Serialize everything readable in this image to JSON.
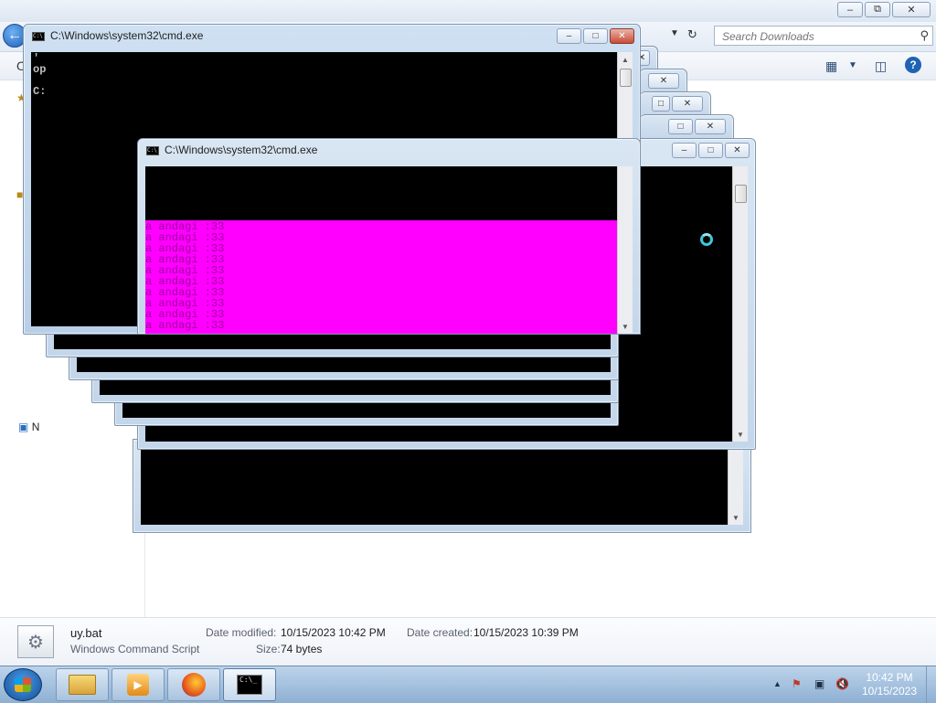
{
  "explorer": {
    "search_placeholder": "Search Downloads",
    "nav_network_label": "N",
    "nav_fragment_o": "O"
  },
  "details": {
    "file_name": "uy.bat",
    "file_type": "Windows Command Script",
    "date_modified_label": "Date modified:",
    "date_modified": "10/15/2023 10:42 PM",
    "date_created_label": "Date created:",
    "date_created": "10/15/2023 10:39 PM",
    "size_label": "Size:",
    "size": "74 bytes"
  },
  "cmd": {
    "window_title": "C:\\Windows\\system32\\cmd.exe",
    "fragments": [
      "'",
      "op",
      "C:"
    ],
    "output_line": "a andagi :33",
    "output_lines_visible": 10
  },
  "colors": {
    "console_bg": "#000000",
    "highlight_bg": "#ff00ff",
    "highlight_text": "#a100a1"
  },
  "taskbar": {
    "apps": [
      {
        "icon": "folder-icon",
        "name": "Windows Explorer"
      },
      {
        "icon": "media-player-icon",
        "name": "Media Player"
      },
      {
        "icon": "firefox-icon",
        "name": "Firefox"
      },
      {
        "icon": "cmd-icon",
        "name": "Command Prompt"
      }
    ],
    "clock_time": "10:42 PM",
    "clock_date": "10/15/2023"
  }
}
